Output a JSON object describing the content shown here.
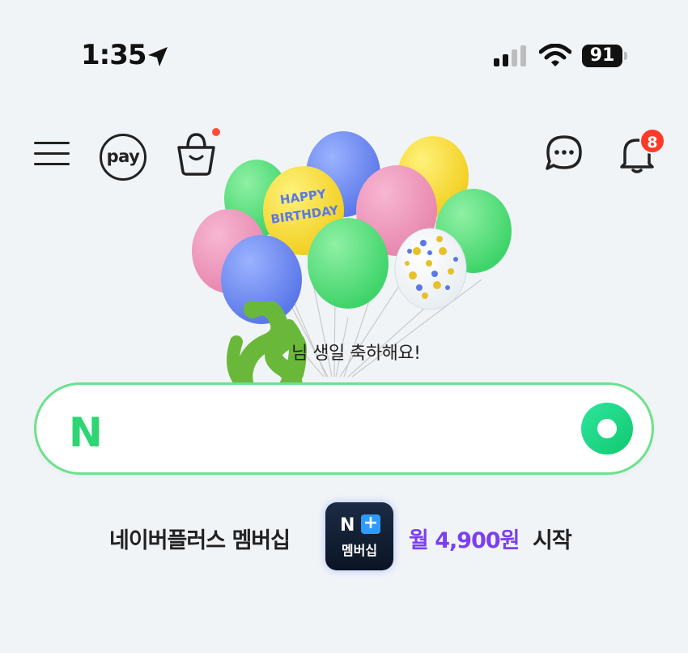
{
  "status_bar": {
    "time": "1:35",
    "battery": "91"
  },
  "nav": {
    "pay_label": "pay",
    "notification_count": "8"
  },
  "greeting": "님 생일 축하해요!",
  "balloon_text": "HAPPY BIRTHDAY",
  "search": {
    "logo": "N",
    "value": "",
    "placeholder": ""
  },
  "membership": {
    "label": "네이버플러스 멤버십",
    "badge_n": "N",
    "badge_plus": "+",
    "badge_text": "멤버십",
    "price": "월 4,900원",
    "suffix": "시작"
  },
  "colors": {
    "accent_green": "#2ed573",
    "price_purple": "#7b3ff2",
    "badge_red": "#ff3a28"
  }
}
